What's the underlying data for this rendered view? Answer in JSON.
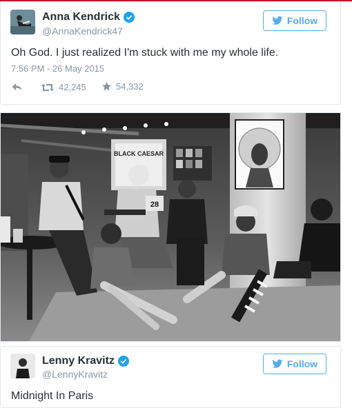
{
  "tweets": [
    {
      "name": "Anna Kendrick",
      "handle": "@AnnaKendrick47",
      "follow_label": "Follow",
      "text": "Oh God.  I just realized I'm stuck with me my whole life.",
      "timestamp": "7:56 PM - 26 May 2015",
      "retweets": "42,245",
      "likes": "54,332"
    },
    {
      "name": "Lenny Kravitz",
      "handle": "@LennyKravitz",
      "follow_label": "Follow",
      "text": "Midnight In Paris"
    }
  ],
  "photo": {
    "sign_text": "BLACK CAESAR",
    "shirt_number": "28"
  },
  "colors": {
    "accent": "#55acee",
    "verified": "#1da1f2",
    "muted": "#8899a6",
    "text": "#292f33"
  },
  "icons": [
    "twitter-bird-icon",
    "verified-badge-icon",
    "reply-icon",
    "retweet-icon",
    "star-icon"
  ]
}
